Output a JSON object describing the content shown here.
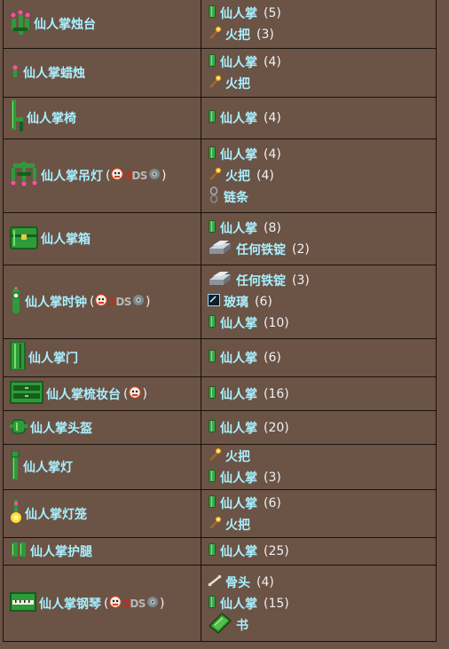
{
  "rows": [
    {
      "name": "仙人掌烛台",
      "icon": "cactus-candelabra",
      "badges": "",
      "ingredients": [
        {
          "name": "仙人掌",
          "qty": "(5)",
          "icon": "cactus"
        },
        {
          "name": "火把",
          "qty": "(3)",
          "icon": "torch"
        }
      ]
    },
    {
      "name": "仙人掌蜡烛",
      "icon": "cactus-candle",
      "badges": "",
      "ingredients": [
        {
          "name": "仙人掌",
          "qty": "(4)",
          "icon": "cactus"
        },
        {
          "name": "火把",
          "qty": "",
          "icon": "torch"
        }
      ]
    },
    {
      "name": "仙人掌椅",
      "icon": "cactus-chair",
      "badges": "",
      "ingredients": [
        {
          "name": "仙人掌",
          "qty": "(4)",
          "icon": "cactus"
        }
      ]
    },
    {
      "name": "仙人掌吊灯",
      "icon": "cactus-chandelier",
      "badges": "old-3ds",
      "ingredients": [
        {
          "name": "仙人掌",
          "qty": "(4)",
          "icon": "cactus"
        },
        {
          "name": "火把",
          "qty": "(4)",
          "icon": "torch"
        },
        {
          "name": "链条",
          "qty": "",
          "icon": "chain"
        }
      ]
    },
    {
      "name": "仙人掌箱",
      "icon": "cactus-chest",
      "badges": "",
      "ingredients": [
        {
          "name": "仙人掌",
          "qty": "(8)",
          "icon": "cactus"
        },
        {
          "name": "任何铁锭",
          "qty": "(2)",
          "icon": "iron-bar"
        }
      ]
    },
    {
      "name": "仙人掌时钟",
      "icon": "cactus-clock",
      "badges": "old-3ds",
      "ingredients": [
        {
          "name": "任何铁锭",
          "qty": "(3)",
          "icon": "iron-bar"
        },
        {
          "name": "玻璃",
          "qty": "(6)",
          "icon": "glass"
        },
        {
          "name": "仙人掌",
          "qty": "(10)",
          "icon": "cactus"
        }
      ]
    },
    {
      "name": "仙人掌门",
      "icon": "cactus-door",
      "badges": "",
      "ingredients": [
        {
          "name": "仙人掌",
          "qty": "(6)",
          "icon": "cactus"
        }
      ]
    },
    {
      "name": "仙人掌梳妆台",
      "icon": "cactus-dresser",
      "badges": "old",
      "ingredients": [
        {
          "name": "仙人掌",
          "qty": "(16)",
          "icon": "cactus"
        }
      ]
    },
    {
      "name": "仙人掌头盔",
      "icon": "cactus-helmet",
      "badges": "",
      "ingredients": [
        {
          "name": "仙人掌",
          "qty": "(20)",
          "icon": "cactus"
        }
      ]
    },
    {
      "name": "仙人掌灯",
      "icon": "cactus-lamp",
      "badges": "",
      "ingredients": [
        {
          "name": "火把",
          "qty": "",
          "icon": "torch"
        },
        {
          "name": "仙人掌",
          "qty": "(3)",
          "icon": "cactus"
        }
      ]
    },
    {
      "name": "仙人掌灯笼",
      "icon": "cactus-lantern",
      "badges": "",
      "ingredients": [
        {
          "name": "仙人掌",
          "qty": "(6)",
          "icon": "cactus"
        },
        {
          "name": "火把",
          "qty": "",
          "icon": "torch"
        }
      ]
    },
    {
      "name": "仙人掌护腿",
      "icon": "cactus-leggings",
      "badges": "",
      "ingredients": [
        {
          "name": "仙人掌",
          "qty": "(25)",
          "icon": "cactus"
        }
      ]
    },
    {
      "name": "仙人掌钢琴",
      "icon": "cactus-piano",
      "badges": "old-3ds",
      "ingredients": [
        {
          "name": "骨头",
          "qty": "(4)",
          "icon": "bone"
        },
        {
          "name": "仙人掌",
          "qty": "(15)",
          "icon": "cactus"
        },
        {
          "name": "书",
          "qty": "",
          "icon": "book"
        }
      ]
    }
  ],
  "labels": {
    "open_paren": "(",
    "close_paren": ")",
    "three": "3",
    "ds": "DS"
  },
  "colors": {
    "background": "#6b5346",
    "border": "#1b110c",
    "link": "#a8f0ff",
    "cactus": "#3aa84a"
  }
}
